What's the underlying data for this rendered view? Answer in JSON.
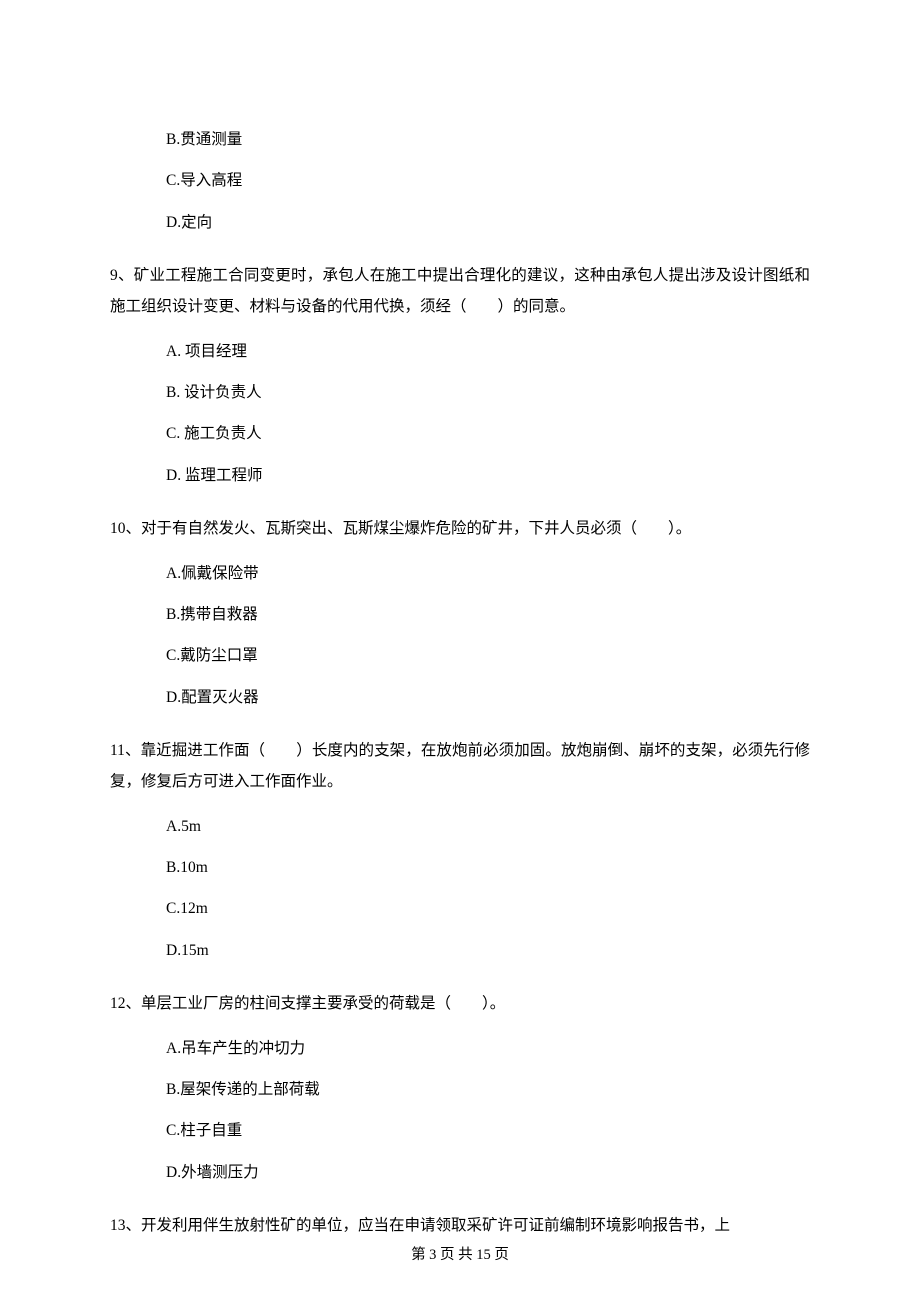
{
  "q8": {
    "optB": "B.贯通测量",
    "optC": "C.导入高程",
    "optD": "D.定向"
  },
  "q9": {
    "text": "9、矿业工程施工合同变更时，承包人在施工中提出合理化的建议，这种由承包人提出涉及设计图纸和施工组织设计变更、材料与设备的代用代换，须经（　　）的同意。",
    "optA": "A. 项目经理",
    "optB": "B. 设计负责人",
    "optC": "C. 施工负责人",
    "optD": "D. 监理工程师"
  },
  "q10": {
    "text": "10、对于有自然发火、瓦斯突出、瓦斯煤尘爆炸危险的矿井，下井人员必须（　　）。",
    "optA": "A.佩戴保险带",
    "optB": "B.携带自救器",
    "optC": "C.戴防尘口罩",
    "optD": "D.配置灭火器"
  },
  "q11": {
    "text": "11、靠近掘进工作面（　　）长度内的支架，在放炮前必须加固。放炮崩倒、崩坏的支架，必须先行修复，修复后方可进入工作面作业。",
    "optA": "A.5m",
    "optB": "B.10m",
    "optC": "C.12m",
    "optD": "D.15m"
  },
  "q12": {
    "text": "12、单层工业厂房的柱间支撑主要承受的荷载是（　　）。",
    "optA": "A.吊车产生的冲切力",
    "optB": "B.屋架传递的上部荷载",
    "optC": "C.柱子自重",
    "optD": "D.外墙测压力"
  },
  "q13": {
    "text": "13、开发利用伴生放射性矿的单位，应当在申请领取采矿许可证前编制环境影响报告书，上"
  },
  "footer": "第 3 页 共 15 页"
}
